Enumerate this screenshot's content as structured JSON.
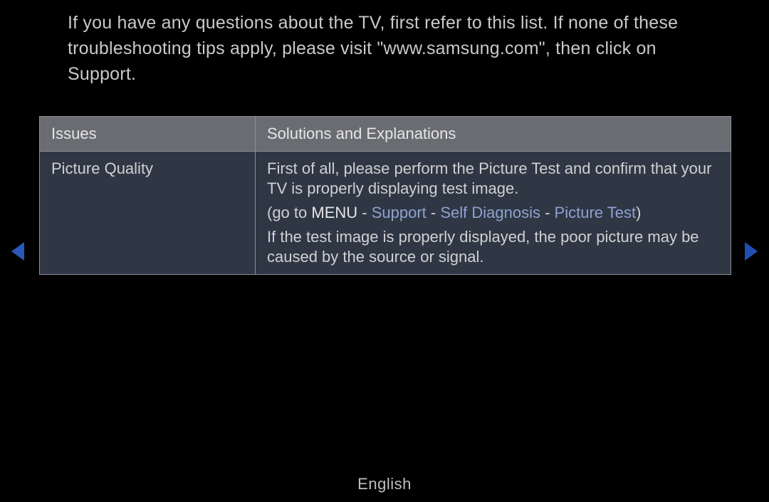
{
  "intro": "If you have any questions about the TV, first refer to this list. If none of these troubleshooting tips apply, please visit \"www.samsung.com\", then click on Support.",
  "table": {
    "header": {
      "issues": "Issues",
      "solutions": "Solutions and Explanations"
    },
    "row": {
      "issue": "Picture Quality",
      "solution_line1": "First of all, please perform the Picture Test and confirm that your TV is properly displaying test image.",
      "goto": {
        "open": "(go to ",
        "menu": "MENU",
        "sep": " - ",
        "support": "Support",
        "self_diag": "Self Diagnosis",
        "picture_test": "Picture Test",
        "close": ")"
      },
      "solution_line3": "If the test image is properly displayed, the poor picture may be caused by the source or signal."
    }
  },
  "footer": {
    "language": "English"
  },
  "colors": {
    "arrow_left": "#2a58b8",
    "arrow_right": "#1f4fb3"
  }
}
